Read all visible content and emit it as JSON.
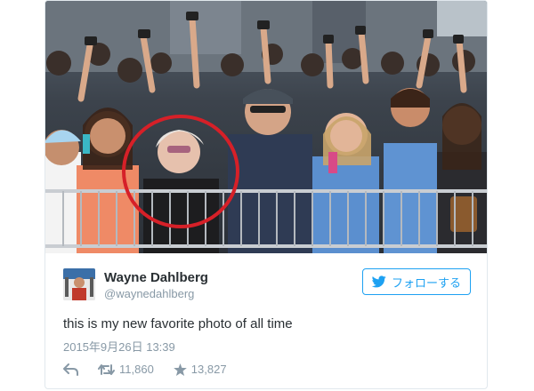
{
  "tweet": {
    "author_name": "Wayne Dahlberg",
    "author_handle": "@waynedahlberg",
    "follow_label": "フォローする",
    "text": "this is my new favorite photo of all time",
    "timestamp": "2015年9月26日 13:39",
    "retweets": "11,860",
    "likes": "13,827"
  },
  "icons": {
    "reply": "reply-icon",
    "retweet": "retweet-icon",
    "like": "star-icon",
    "follow": "bird-icon"
  },
  "colors": {
    "accent": "#1da1f2",
    "name": "#292f33",
    "meta": "#8899a6",
    "highlight_circle": "#d62028"
  }
}
